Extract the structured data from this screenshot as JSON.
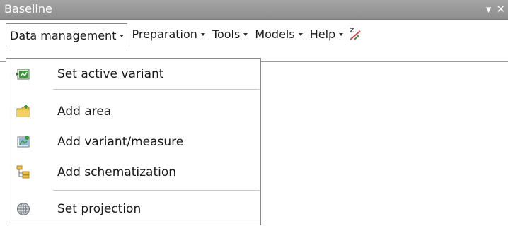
{
  "window": {
    "title": "Baseline",
    "pin_glyph": "▾",
    "close_glyph": "✕"
  },
  "menubar": {
    "items": [
      {
        "label": "Data management",
        "active": true
      },
      {
        "label": "Preparation"
      },
      {
        "label": "Tools"
      },
      {
        "label": "Models"
      },
      {
        "label": "Help"
      }
    ],
    "extra_icon": "zoom-tool-icon"
  },
  "dropdown": {
    "items": [
      {
        "label": "Set active variant",
        "icon": "set-active-variant-icon"
      },
      {
        "label": "Add area",
        "icon": "add-area-folder-icon"
      },
      {
        "label": "Add variant/measure",
        "icon": "add-variant-measure-icon"
      },
      {
        "label": "Add schematization",
        "icon": "add-schematization-icon"
      },
      {
        "label": "Set projection",
        "icon": "globe-icon"
      }
    ]
  },
  "colors": {
    "titlebar": "#9a9a9a",
    "accent_green": "#3a9a3a",
    "folder_yellow": "#e8c04a"
  }
}
